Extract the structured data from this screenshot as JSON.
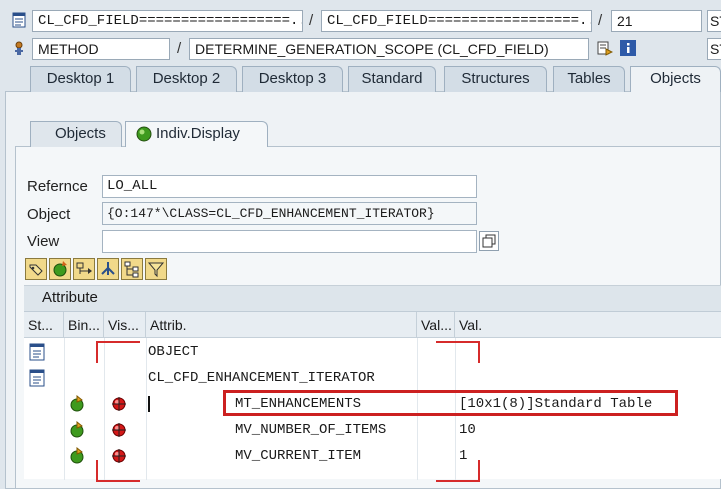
{
  "top": {
    "class_field_1": "CL_CFD_FIELD==================...",
    "class_field_2": "CL_CFD_FIELD==================...",
    "line_number": "21",
    "row1_trunc": "ST",
    "method_type": "METHOD",
    "method_name": "DETERMINE_GENERATION_SCOPE (CL_CFD_FIELD)",
    "row2_trunc": "ST",
    "separator": "/"
  },
  "tabs": [
    "Desktop 1",
    "Desktop 2",
    "Desktop 3",
    "Standard",
    "Structures",
    "Tables",
    "Objects"
  ],
  "active_tab": "Objects",
  "subtabs": [
    "Objects",
    "Indiv.Display"
  ],
  "active_subtab": "Indiv.Display",
  "form": {
    "reference_label": "Refernce",
    "reference_value": "LO_ALL",
    "object_label": "Object",
    "object_value": "{O:147*\\CLASS=CL_CFD_ENHANCEMENT_ITERATOR}",
    "view_label": "View",
    "view_value": ""
  },
  "toolbar_icons": [
    "pencil-tag-icon",
    "cycle-icon",
    "structure-icon",
    "hierarchy-icon",
    "tree-icon",
    "filter-icon"
  ],
  "attribute_header": "Attribute",
  "columns": [
    "St...",
    "Bin...",
    "Vis...",
    "Attrib.",
    "Val...",
    "Val."
  ],
  "rows": [
    {
      "st_icon": "document-icon",
      "bin_icon": "",
      "vis_icon": "",
      "attrib": "OBJECT",
      "val_type": "",
      "val": ""
    },
    {
      "st_icon": "document-icon",
      "bin_icon": "",
      "vis_icon": "",
      "attrib": "CL_CFD_ENHANCEMENT_ITERATOR",
      "val_type": "",
      "val": ""
    },
    {
      "st_icon": "",
      "bin_icon": "binding-icon",
      "vis_icon": "private-icon",
      "attrib": "MT_ENHANCEMENTS",
      "val_type": "",
      "val": "[10x1(8)]Standard Table"
    },
    {
      "st_icon": "",
      "bin_icon": "binding-icon",
      "vis_icon": "private-icon",
      "attrib": "MV_NUMBER_OF_ITEMS",
      "val_type": "",
      "val": "10"
    },
    {
      "st_icon": "",
      "bin_icon": "binding-icon",
      "vis_icon": "private-icon",
      "attrib": "MV_CURRENT_ITEM",
      "val_type": "",
      "val": "1"
    }
  ],
  "colors": {
    "highlight": "#cc2020",
    "tab_bg": "#d3dde6",
    "panel_bg": "#eef2f5"
  }
}
